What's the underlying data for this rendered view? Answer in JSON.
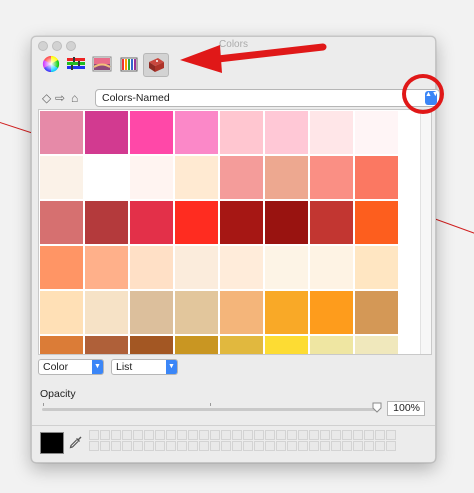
{
  "window": {
    "title": "Colors"
  },
  "toolbar": {
    "tabs": [
      {
        "name": "color-wheel-icon",
        "selected": false
      },
      {
        "name": "color-sliders-icon",
        "selected": false
      },
      {
        "name": "color-palettes-icon",
        "selected": false
      },
      {
        "name": "image-palettes-icon",
        "selected": false
      },
      {
        "name": "crayons-icon",
        "selected": true
      }
    ]
  },
  "nav": {
    "back_glyph": "◇",
    "forward_glyph": "⇨",
    "home_glyph": "⌂",
    "palette_name": "Colors-Named",
    "stepper_glyph": "▲▼"
  },
  "swatches": [
    "#e68aa8",
    "#d23a90",
    "#ff48a8",
    "#fb88c8",
    "#ffc6d0",
    "#ffc8d6",
    "#ffe6e8",
    "#fff5f6",
    "#fbf2e8",
    "#ffffff",
    "#fff4f1",
    "#ffead2",
    "#f49c9a",
    "#eda890",
    "#fa8f84",
    "#fb7862",
    "#d67070",
    "#b43a3c",
    "#e33049",
    "#ff2c20",
    "#a61714",
    "#991310",
    "#c23631",
    "#fd5e1e",
    "#ff9565",
    "#ffb08a",
    "#ffe0c6",
    "#fbecdc",
    "#ffecda",
    "#fdf4e6",
    "#fef3e4",
    "#ffe6c2",
    "#ffe0b6",
    "#f6e2c6",
    "#dcbf9c",
    "#e2c69c",
    "#f4b57a",
    "#f9a927",
    "#fe9c1c",
    "#d49856",
    "#db7c37",
    "#af6039",
    "#a35723",
    "#c99622",
    "#e1b83e",
    "#fddc33",
    "#efe6a2",
    "#f0e8bc"
  ],
  "footer": {
    "mode_select": "Color",
    "view_select": "List",
    "select_arrow": "▼",
    "opacity_label": "Opacity",
    "opacity_value": "100%",
    "opacity_level": 1.0,
    "current_color": "#000000",
    "favorite_slots": 56
  },
  "annotations": {
    "arrow_color": "#e01818",
    "circle_color": "#e01818"
  }
}
